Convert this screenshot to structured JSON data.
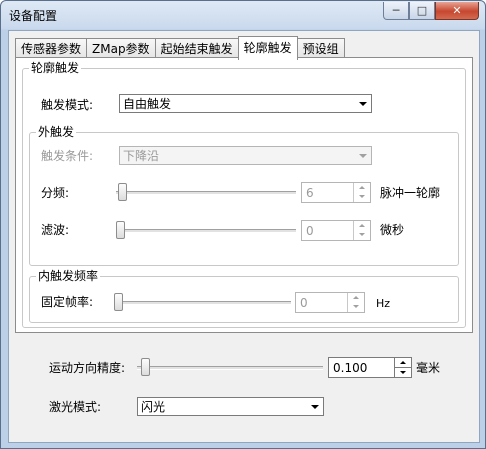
{
  "window": {
    "title": "设备配置"
  },
  "tabs": [
    {
      "label": "传感器参数"
    },
    {
      "label": "ZMap参数"
    },
    {
      "label": "起始结束触发"
    },
    {
      "label": "轮廓触发"
    },
    {
      "label": "预设组"
    }
  ],
  "contour_trigger": {
    "group_title": "轮廓触发",
    "mode_label": "触发模式:",
    "mode_value": "自由触发",
    "external": {
      "group_title": "外触发",
      "condition_label": "触发条件:",
      "condition_value": "下降沿",
      "divide_label": "分频:",
      "divide_value": "6",
      "divide_unit": "脉冲一轮廓",
      "filter_label": "滤波:",
      "filter_value": "0",
      "filter_unit": "微秒"
    },
    "internal": {
      "group_title": "内触发频率",
      "rate_label": "固定帧率:",
      "rate_value": "0",
      "rate_unit": "Hz"
    }
  },
  "motion": {
    "precision_label": "运动方向精度:",
    "precision_value": "0.100",
    "precision_unit": "毫米"
  },
  "laser": {
    "mode_label": "激光模式:",
    "mode_value": "闪光"
  }
}
